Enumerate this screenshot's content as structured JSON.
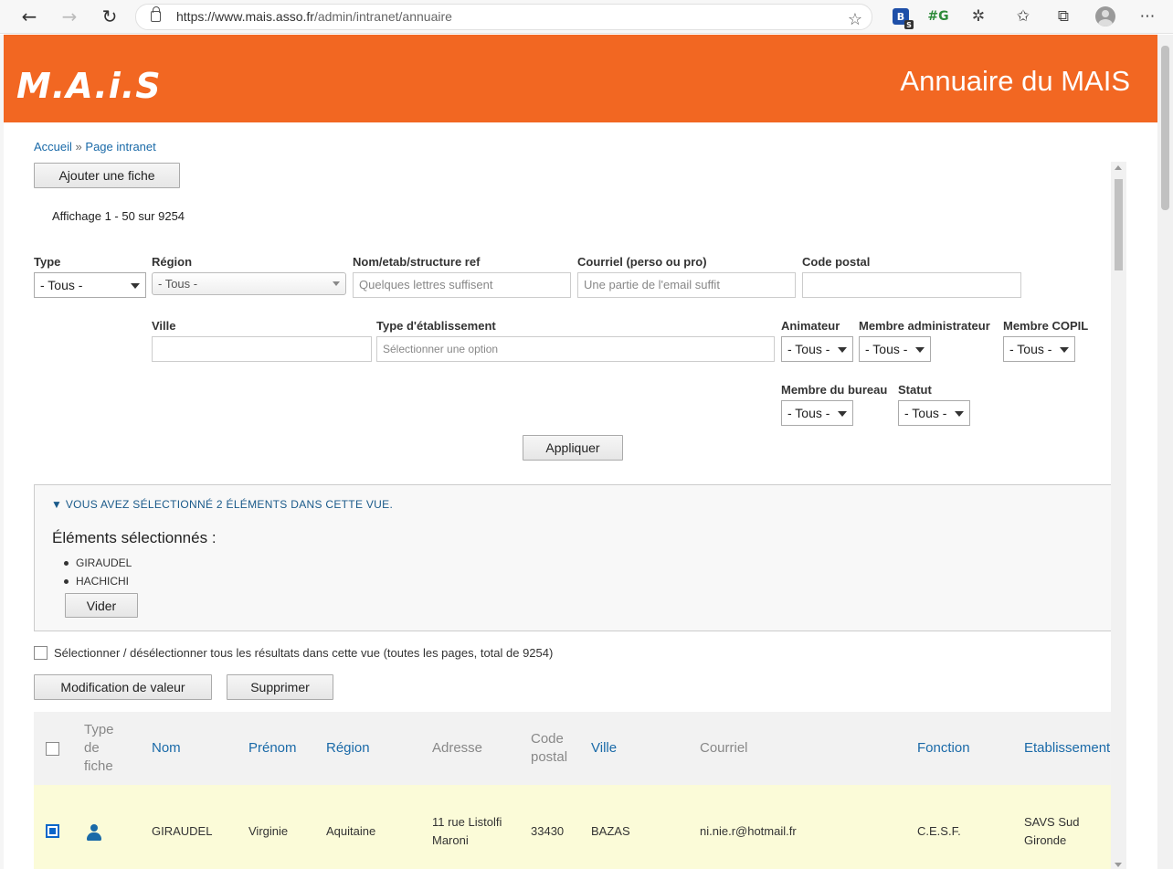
{
  "browser": {
    "url_host": "https://www.mais.asso.fr",
    "url_path": "/admin/intranet/annuaire"
  },
  "site": {
    "logo_text": "M.A.i.S",
    "title": "Annuaire du MAIS",
    "brand_color": "#f26722"
  },
  "breadcrumb": {
    "home": "Accueil",
    "separator": "»",
    "current": "Page intranet"
  },
  "actions": {
    "add_record": "Ajouter une fiche"
  },
  "pager": {
    "summary": "Affichage 1 - 50 sur 9254"
  },
  "filters": {
    "type": {
      "label": "Type",
      "value": "- Tous -"
    },
    "region": {
      "label": "Région",
      "value": "- Tous -"
    },
    "name": {
      "label": "Nom/etab/structure ref",
      "placeholder": "Quelques lettres suffisent"
    },
    "email": {
      "label": "Courriel (perso ou pro)",
      "placeholder": "Une partie de l'email suffit"
    },
    "postcode": {
      "label": "Code postal",
      "value": ""
    },
    "city": {
      "label": "Ville",
      "value": ""
    },
    "establishment_type": {
      "label": "Type d'établissement",
      "placeholder": "Sélectionner une option"
    },
    "animator": {
      "label": "Animateur",
      "value": "- Tous -"
    },
    "admin_member": {
      "label": "Membre administrateur",
      "value": "- Tous -"
    },
    "copil_member": {
      "label": "Membre COPIL",
      "value": "- Tous -"
    },
    "bureau_member": {
      "label": "Membre du bureau",
      "value": "- Tous -"
    },
    "status": {
      "label": "Statut",
      "value": "- Tous -"
    },
    "apply": "Appliquer"
  },
  "selection": {
    "summary": "Vous avez sélectionné 2 éléments dans cette vue.",
    "title": "Éléments sélectionnés :",
    "items": [
      "GIRAUDEL",
      "HACHICHI"
    ],
    "clear": "Vider"
  },
  "bulk": {
    "select_all": "Sélectionner / désélectionner tous les résultats dans cette vue (toutes les pages, total de 9254)",
    "modify": "Modification de valeur",
    "delete": "Supprimer"
  },
  "table": {
    "columns": {
      "type": [
        "Type",
        "de",
        "fiche"
      ],
      "name": "Nom",
      "firstname": "Prénom",
      "region": "Région",
      "address": "Adresse",
      "postcode": [
        "Code",
        "postal"
      ],
      "city": "Ville",
      "email": "Courriel",
      "function": "Fonction",
      "establishment": "Etablissement"
    },
    "rows": [
      {
        "checked": true,
        "type_icon": "person-icon",
        "name": "GIRAUDEL",
        "firstname": "Virginie",
        "region": "Aquitaine",
        "address": [
          "11 rue Listolfi",
          "Maroni"
        ],
        "postcode": "33430",
        "city": "BAZAS",
        "email": "ni.nie.r@hotmail.fr",
        "function": "C.E.S.F.",
        "establishment": [
          "SAVS Sud",
          "Gironde"
        ]
      }
    ]
  }
}
